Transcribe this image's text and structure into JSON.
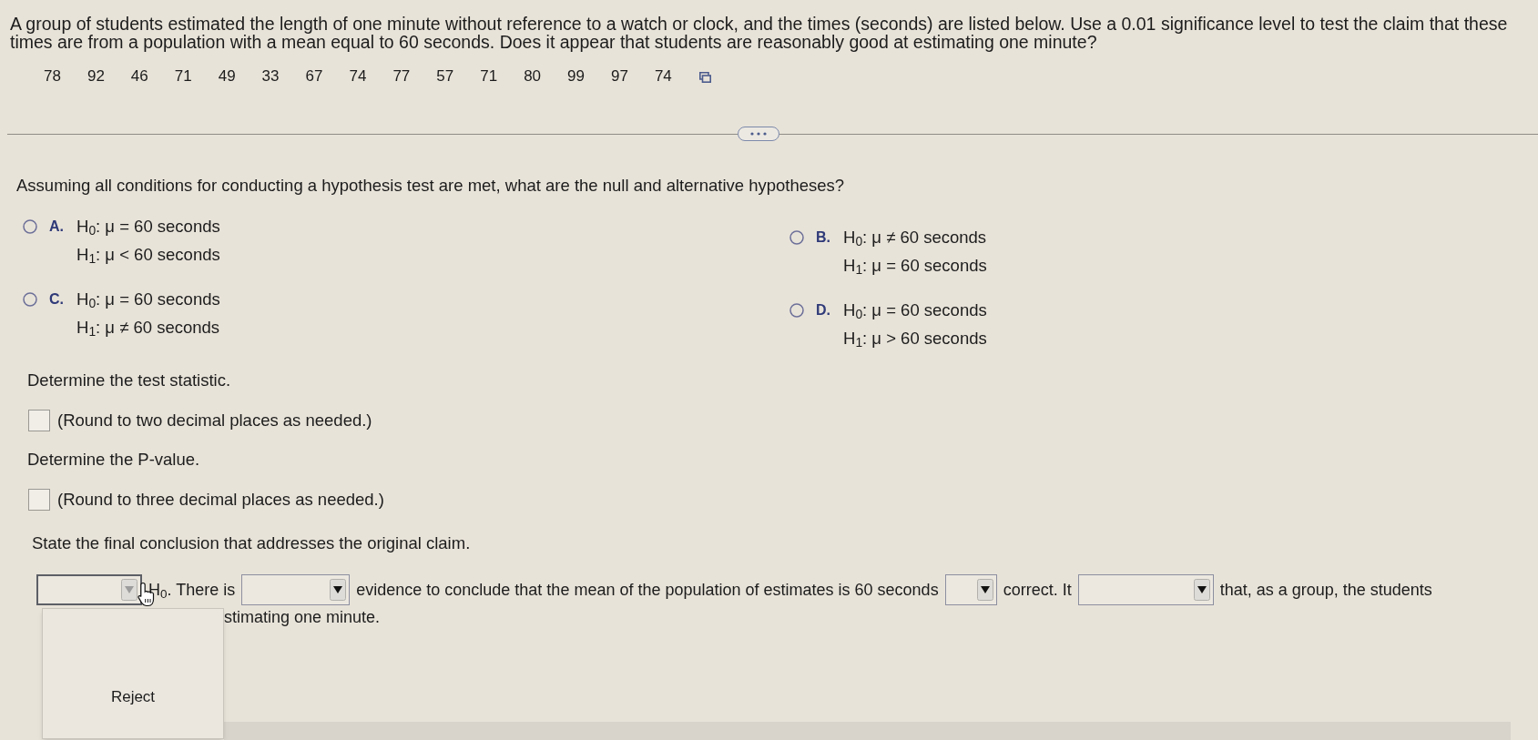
{
  "question": {
    "text": "A group of students estimated the length of one minute without reference to a watch or clock, and the times (seconds) are listed below. Use a 0.01 significance level to test the claim that these times are from a population with a mean equal to 60 seconds. Does it appear that students are reasonably good at estimating one minute?",
    "data": [
      "78",
      "92",
      "46",
      "71",
      "49",
      "33",
      "67",
      "74",
      "77",
      "57",
      "71",
      "80",
      "99",
      "97",
      "74"
    ]
  },
  "hypotheses": {
    "prompt": "Assuming all conditions for conducting a hypothesis test are met, what are the null and alternative hypotheses?",
    "options": [
      {
        "letter": "A.",
        "h0": "H$_{0}$: μ = 60 seconds",
        "h1": "H$_{1}$: μ < 60 seconds",
        "selected": false
      },
      {
        "letter": "B.",
        "h0": "H$_{0}$: μ ≠ 60 seconds",
        "h1": "H$_{1}$: μ = 60 seconds",
        "selected": false
      },
      {
        "letter": "C.",
        "h0": "H$_{0}$: μ = 60 seconds",
        "h1": "H$_{1}$: μ ≠ 60 seconds",
        "selected": false
      },
      {
        "letter": "D.",
        "h0": "H$_{0}$: μ = 60 seconds",
        "h1": "H$_{1}$: μ > 60 seconds",
        "selected": false
      }
    ]
  },
  "steps": [
    {
      "prompt": "Determine the test statistic.",
      "hint": "(Round to two decimal places as needed.)"
    },
    {
      "prompt": "Determine the P-value.",
      "hint": "(Round to three decimal places as needed.)"
    }
  ],
  "conclusion": {
    "prompt": "State the final conclusion that addresses the original claim.",
    "lines": [
      [
        {
          "kind": "dropdown",
          "expanded": true,
          "options": [
            "Reject"
          ]
        },
        {
          "kind": "text",
          "text": "H$_{0}$. There is"
        },
        {
          "kind": "dropdown",
          "expanded": false
        },
        {
          "kind": "text",
          "text": "evidence to conclude that the mean of the population of estimates is 60 seconds"
        },
        {
          "kind": "dropdown",
          "expanded": false
        },
        {
          "kind": "text",
          "text": "correct. It"
        },
        {
          "kind": "dropdown",
          "expanded": false
        },
        {
          "kind": "text",
          "text": "that, as a group, the students"
        }
      ],
      [
        {
          "kind": "text",
          "text": "stimating one minute."
        }
      ]
    ]
  }
}
